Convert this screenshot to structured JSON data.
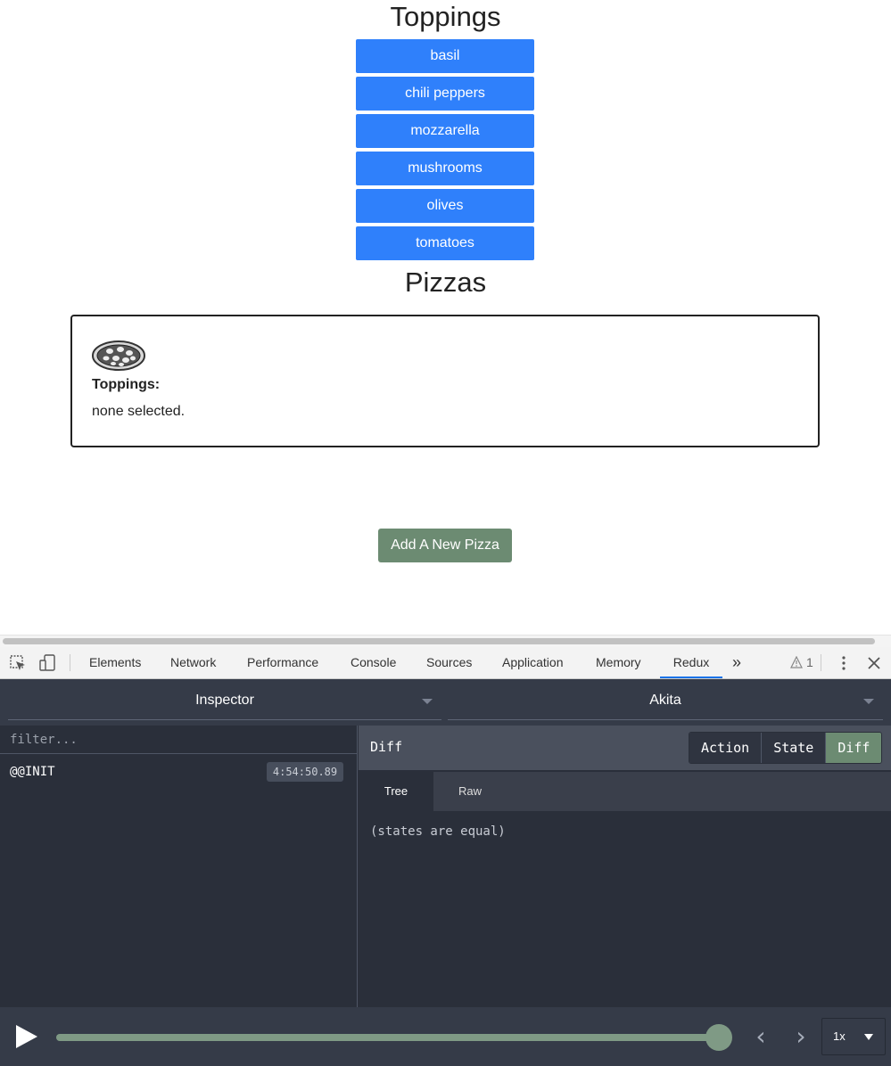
{
  "app": {
    "toppings_title": "Toppings",
    "toppings": [
      "basil",
      "chili peppers",
      "mozzarella",
      "mushrooms",
      "olives",
      "tomatoes"
    ],
    "pizzas_title": "Pizzas",
    "pizza_card": {
      "icon": "pizza-icon",
      "toppings_label": "Toppings:",
      "toppings_value": "none selected."
    },
    "add_button": "Add A New Pizza",
    "colors": {
      "topping_button": "#2f80fb",
      "add_button": "#6c8b72"
    }
  },
  "devtools": {
    "icons": {
      "inspect": "inspect-element-icon",
      "device": "device-toolbar-icon",
      "more": "more-tabs-icon",
      "warning": "warning-icon",
      "menu": "kebab-menu-icon",
      "close": "close-icon"
    },
    "tabs": [
      "Elements",
      "Network",
      "Performance",
      "Console",
      "Sources",
      "Application",
      "Memory",
      "Redux"
    ],
    "active_tab": "Redux",
    "more_tabs": "»",
    "warning_count": "1"
  },
  "redux": {
    "monitor_select": "Inspector",
    "store_select": "Akita",
    "filter_placeholder": "filter...",
    "actions": [
      {
        "name": "@@INIT",
        "time": "4:54:50.89"
      }
    ],
    "panel_title": "Diff",
    "segments": [
      "Action",
      "State",
      "Diff"
    ],
    "active_segment": "Diff",
    "subtabs": [
      "Tree",
      "Raw"
    ],
    "active_subtab": "Tree",
    "diff_content": "(states are equal)",
    "slider_progress": 1.0,
    "prev": "‹",
    "next": "›",
    "speed": "1x"
  }
}
